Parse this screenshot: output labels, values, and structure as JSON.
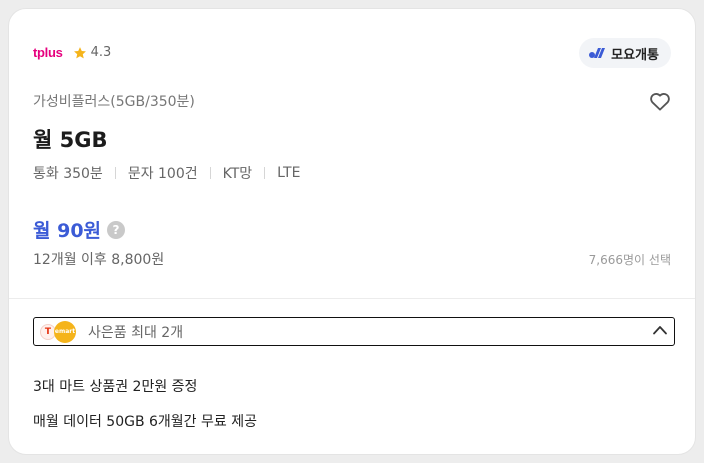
{
  "carrier": {
    "logo_text": "tplus",
    "rating": "4.3",
    "star_color": "#f5b41b",
    "logo_color": "#e6007e"
  },
  "badge": {
    "label": "모요개통",
    "icon": "moyo-logo-icon",
    "icon_color": "#3b5bd6"
  },
  "plan": {
    "name": "가성비플러스(5GB/350분)",
    "data": "월 5GB",
    "specs": [
      "통화 350분",
      "문자 100건",
      "KT망",
      "LTE"
    ]
  },
  "price": {
    "monthly": "월 90원",
    "after": "12개월 이후 8,800원",
    "selected_count": "7,666명이 선택",
    "color": "#3b5bd6"
  },
  "gift": {
    "label": "사은품 최대 2개",
    "icons": [
      "T",
      "emart"
    ],
    "expanded": true
  },
  "benefits": [
    "3대 마트 상품권 2만원 증정",
    "매월 데이터 50GB 6개월간 무료 제공"
  ]
}
